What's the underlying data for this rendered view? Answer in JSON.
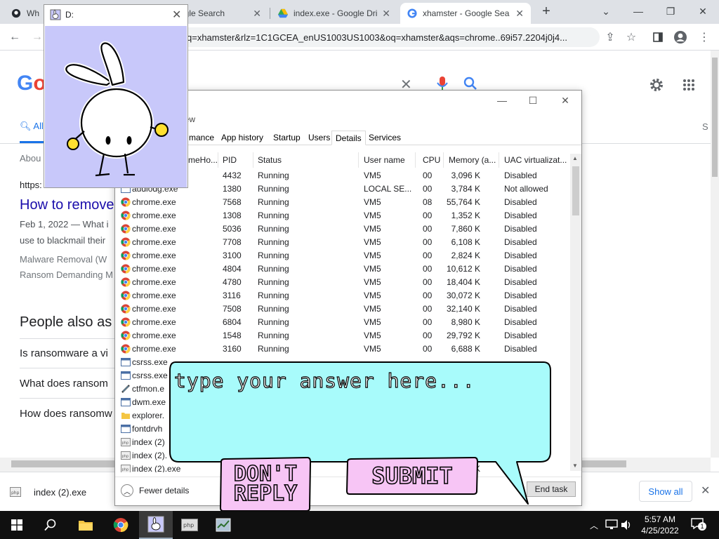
{
  "browser": {
    "tabs": [
      {
        "title": "Wh",
        "favicon": "github-icon"
      },
      {
        "title": "ogle Search",
        "favicon": "google-icon"
      },
      {
        "title": "index.exe - Google Dri",
        "favicon": "google-drive-icon"
      },
      {
        "title": "xhamster - Google Sea",
        "favicon": "google-icon",
        "active": true
      }
    ],
    "url": "q=xhamster&rlz=1C1GCEA_enUS1003US1003&oq=xhamster&aqs=chrome..69i57.2204j0j4..."
  },
  "google": {
    "logo": "Go",
    "tab_all": "All",
    "about": "Abou",
    "result_url": "https:",
    "result_title": "How to remove",
    "result_snippet_1": "Feb 1, 2022 — What i",
    "result_snippet_2": "use to blackmail their",
    "related_1": "Malware Removal (W",
    "related_2": "Ransom Demanding M",
    "paa_heading": "People also as",
    "paa": [
      "Is ransomware a vi",
      "What does ransom",
      "How does ransomw"
    ],
    "side_letter": "S"
  },
  "download": {
    "filename": "index (2).exe",
    "show_all": "Show all"
  },
  "bunny_window": {
    "title": "D:"
  },
  "taskmanager": {
    "menu_view": "iew",
    "tabs": [
      "mance",
      "App history",
      "Startup",
      "Users",
      "Details",
      "Services"
    ],
    "active_tab": "Details",
    "columns": [
      "PID",
      "Status",
      "User name",
      "CPU",
      "Memory (a...",
      "UAC virtualizat..."
    ],
    "first_col_partial": "meHo...",
    "rows": [
      {
        "name": "",
        "pid": "4432",
        "status": "Running",
        "user": "VM5",
        "cpu": "00",
        "mem": "3,096 K",
        "uac": "Disabled",
        "icon": "generic"
      },
      {
        "name": "audiodg.exe",
        "pid": "1380",
        "status": "Running",
        "user": "LOCAL SE...",
        "cpu": "00",
        "mem": "3,784 K",
        "uac": "Not allowed",
        "icon": "generic"
      },
      {
        "name": "chrome.exe",
        "pid": "7568",
        "status": "Running",
        "user": "VM5",
        "cpu": "08",
        "mem": "55,764 K",
        "uac": "Disabled",
        "icon": "chrome"
      },
      {
        "name": "chrome.exe",
        "pid": "1308",
        "status": "Running",
        "user": "VM5",
        "cpu": "00",
        "mem": "1,352 K",
        "uac": "Disabled",
        "icon": "chrome"
      },
      {
        "name": "chrome.exe",
        "pid": "5036",
        "status": "Running",
        "user": "VM5",
        "cpu": "00",
        "mem": "7,860 K",
        "uac": "Disabled",
        "icon": "chrome"
      },
      {
        "name": "chrome.exe",
        "pid": "7708",
        "status": "Running",
        "user": "VM5",
        "cpu": "00",
        "mem": "6,108 K",
        "uac": "Disabled",
        "icon": "chrome"
      },
      {
        "name": "chrome.exe",
        "pid": "3100",
        "status": "Running",
        "user": "VM5",
        "cpu": "00",
        "mem": "2,824 K",
        "uac": "Disabled",
        "icon": "chrome"
      },
      {
        "name": "chrome.exe",
        "pid": "4804",
        "status": "Running",
        "user": "VM5",
        "cpu": "00",
        "mem": "10,612 K",
        "uac": "Disabled",
        "icon": "chrome"
      },
      {
        "name": "chrome.exe",
        "pid": "4780",
        "status": "Running",
        "user": "VM5",
        "cpu": "00",
        "mem": "18,404 K",
        "uac": "Disabled",
        "icon": "chrome"
      },
      {
        "name": "chrome.exe",
        "pid": "3116",
        "status": "Running",
        "user": "VM5",
        "cpu": "00",
        "mem": "30,072 K",
        "uac": "Disabled",
        "icon": "chrome"
      },
      {
        "name": "chrome.exe",
        "pid": "7508",
        "status": "Running",
        "user": "VM5",
        "cpu": "00",
        "mem": "32,140 K",
        "uac": "Disabled",
        "icon": "chrome"
      },
      {
        "name": "chrome.exe",
        "pid": "6804",
        "status": "Running",
        "user": "VM5",
        "cpu": "00",
        "mem": "8,980 K",
        "uac": "Disabled",
        "icon": "chrome"
      },
      {
        "name": "chrome.exe",
        "pid": "1548",
        "status": "Running",
        "user": "VM5",
        "cpu": "00",
        "mem": "29,792 K",
        "uac": "Disabled",
        "icon": "chrome"
      },
      {
        "name": "chrome.exe",
        "pid": "3160",
        "status": "Running",
        "user": "VM5",
        "cpu": "00",
        "mem": "6,688 K",
        "uac": "Disabled",
        "icon": "chrome"
      },
      {
        "name": "csrss.exe",
        "pid": "",
        "status": "",
        "user": "",
        "cpu": "",
        "mem": "",
        "uac": "",
        "icon": "generic"
      },
      {
        "name": "csrss.exe",
        "pid": "",
        "status": "",
        "user": "",
        "cpu": "",
        "mem": "",
        "uac": "",
        "icon": "generic"
      },
      {
        "name": "ctfmon.e",
        "pid": "",
        "status": "",
        "user": "",
        "cpu": "",
        "mem": "",
        "uac": "",
        "icon": "pen"
      },
      {
        "name": "dwm.exe",
        "pid": "",
        "status": "",
        "user": "",
        "cpu": "",
        "mem": "",
        "uac": "",
        "icon": "generic"
      },
      {
        "name": "explorer.",
        "pid": "",
        "status": "",
        "user": "",
        "cpu": "",
        "mem": "",
        "uac": "",
        "icon": "folder"
      },
      {
        "name": "fontdrvh",
        "pid": "",
        "status": "",
        "user": "",
        "cpu": "",
        "mem": "",
        "uac": "",
        "icon": "generic"
      },
      {
        "name": "index (2)",
        "pid": "",
        "status": "",
        "user": "",
        "cpu": "",
        "mem": "",
        "uac": "",
        "icon": "php"
      },
      {
        "name": "index (2).",
        "pid": "",
        "status": "",
        "user": "",
        "cpu": "",
        "mem": "",
        "uac": "",
        "icon": "php"
      },
      {
        "name": "index (2).exe",
        "pid": "",
        "status": "",
        "user": "",
        "cpu": "",
        "mem": "76 K",
        "uac": "d",
        "icon": "php"
      }
    ],
    "fewer_details": "Fewer details",
    "end_task": "End task"
  },
  "popup": {
    "prompt": "type your answer here...",
    "dont_reply_line1": "DON'T",
    "dont_reply_line2": "REPLY",
    "submit": "SUBMIT",
    "bubble_color": "#a8fbfb",
    "button_color": "#f7c5f5"
  },
  "taskbar": {
    "time": "5:57 AM",
    "date": "4/25/2022",
    "notif_count": "1"
  }
}
